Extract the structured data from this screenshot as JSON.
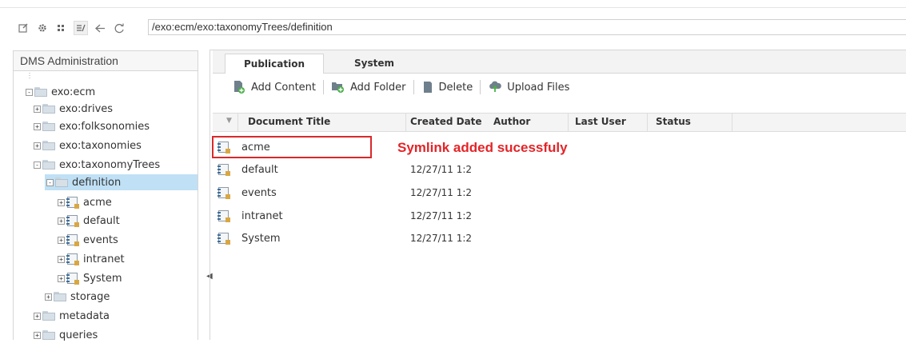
{
  "address_bar": {
    "path": "/exo:ecm/exo:taxonomyTrees/definition"
  },
  "toolbar_icons": [
    "edit-icon",
    "gear-icon",
    "grid-view-icon",
    "list-view-icon",
    "back-icon",
    "refresh-icon"
  ],
  "left_panel": {
    "title": "DMS Administration",
    "tree": [
      {
        "label": "exo:ecm",
        "type": "folder",
        "expander": "-"
      },
      {
        "label": "exo:drives",
        "type": "folder",
        "expander": "+"
      },
      {
        "label": "exo:folksonomies",
        "type": "folder",
        "expander": "+"
      },
      {
        "label": "exo:taxonomies",
        "type": "folder",
        "expander": "+"
      },
      {
        "label": "exo:taxonomyTrees",
        "type": "folder",
        "expander": "-"
      },
      {
        "label": "definition",
        "type": "folder",
        "expander": "-",
        "selected": true
      },
      {
        "label": "acme",
        "type": "doc",
        "expander": "+"
      },
      {
        "label": "default",
        "type": "doc",
        "expander": "+"
      },
      {
        "label": "events",
        "type": "doc",
        "expander": "+"
      },
      {
        "label": "intranet",
        "type": "doc",
        "expander": "+"
      },
      {
        "label": "System",
        "type": "doc",
        "expander": "+"
      },
      {
        "label": "storage",
        "type": "folder",
        "expander": "+"
      },
      {
        "label": "metadata",
        "type": "folder",
        "expander": "+"
      },
      {
        "label": "queries",
        "type": "folder",
        "expander": "+"
      }
    ]
  },
  "tabs": [
    {
      "label": "Publication",
      "active": true
    },
    {
      "label": "System",
      "active": false
    }
  ],
  "actions": {
    "add_content": "Add Content",
    "add_folder": "Add Folder",
    "delete": "Delete",
    "upload_files": "Upload Files"
  },
  "table": {
    "columns": [
      "Document Title",
      "Created Date",
      "Author",
      "Last User",
      "Status"
    ],
    "rows": [
      {
        "title": "acme",
        "created": ""
      },
      {
        "title": "default",
        "created": "12/27/11 1:2"
      },
      {
        "title": "events",
        "created": "12/27/11 1:2"
      },
      {
        "title": "intranet",
        "created": "12/27/11 1:2"
      },
      {
        "title": "System",
        "created": "12/27/11 1:2"
      }
    ]
  },
  "notice": "Symlink added sucessfuly",
  "colors": {
    "notice": "#e32428",
    "selection": "#bfe0f5",
    "highlight_border": "#d9292b"
  }
}
